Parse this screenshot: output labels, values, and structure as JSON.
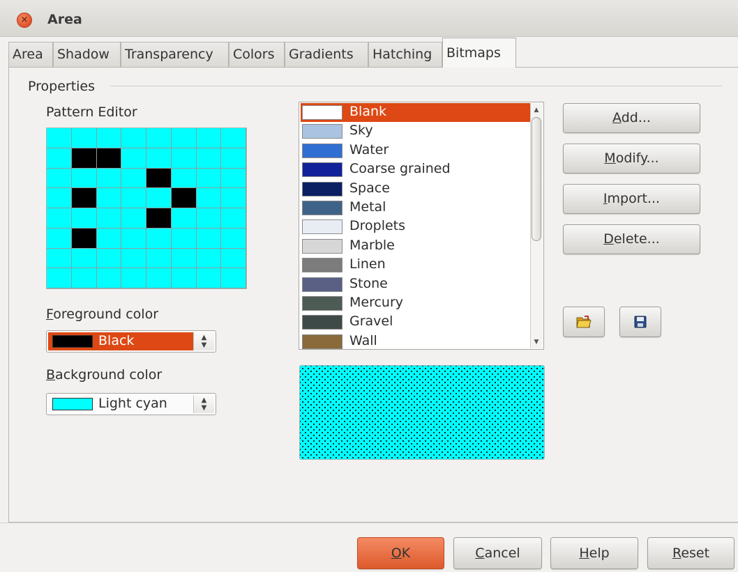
{
  "window": {
    "title": "Area",
    "close_glyph": "×"
  },
  "tabs": [
    {
      "label": "Area",
      "active": false
    },
    {
      "label": "Shadow",
      "active": false
    },
    {
      "label": "Transparency",
      "active": false
    },
    {
      "label": "Colors",
      "active": false
    },
    {
      "label": "Gradients",
      "active": false
    },
    {
      "label": "Hatching",
      "active": false
    },
    {
      "label": "Bitmaps",
      "active": true
    }
  ],
  "properties": {
    "section_label": "Properties",
    "pattern_editor_label": "Pattern Editor",
    "pattern_grid": {
      "rows": 8,
      "cols": 8,
      "cell_color": "#00ffff",
      "on_color": "#000000",
      "on_cells": [
        [
          1,
          1
        ],
        [
          1,
          2
        ],
        [
          2,
          4
        ],
        [
          3,
          1
        ],
        [
          3,
          5
        ],
        [
          4,
          4
        ],
        [
          5,
          1
        ]
      ]
    },
    "foreground": {
      "label_u": "F",
      "label_rest": "oreground color",
      "value": "Black",
      "swatch": "#000000",
      "selected": true
    },
    "background": {
      "label_u": "B",
      "label_rest": "ackground color",
      "value": "Light cyan",
      "swatch": "#00ffff"
    }
  },
  "bitmap_list": {
    "items": [
      {
        "label": "Blank",
        "thumb": "#ffffff",
        "selected": true
      },
      {
        "label": "Sky",
        "thumb": "#a9c3e0"
      },
      {
        "label": "Water",
        "thumb": "#2f6fd1"
      },
      {
        "label": "Coarse grained",
        "thumb": "#12229a"
      },
      {
        "label": "Space",
        "thumb": "#0b1f63"
      },
      {
        "label": "Metal",
        "thumb": "#3f6388"
      },
      {
        "label": "Droplets",
        "thumb": "#e8edf4"
      },
      {
        "label": "Marble",
        "thumb": "#d7d7d7"
      },
      {
        "label": "Linen",
        "thumb": "#7c7c7c"
      },
      {
        "label": "Stone",
        "thumb": "#596084"
      },
      {
        "label": "Mercury",
        "thumb": "#4c5c55"
      },
      {
        "label": "Gravel",
        "thumb": "#3e4a48"
      },
      {
        "label": "Wall",
        "thumb": "#8a6a3a"
      }
    ],
    "selection_color": "#dd4814"
  },
  "preview": {
    "background": "#00ffff"
  },
  "actions": [
    {
      "u": "A",
      "rest": "dd..."
    },
    {
      "u": "M",
      "rest": "odify..."
    },
    {
      "u": "I",
      "rest": "mport..."
    },
    {
      "u": "D",
      "rest": "elete..."
    }
  ],
  "footer": {
    "ok": {
      "u": "O",
      "rest": "K"
    },
    "cancel": {
      "u": "C",
      "rest": "ancel"
    },
    "help": {
      "u": "H",
      "rest": "elp"
    },
    "reset": {
      "u": "R",
      "rest": "eset"
    }
  },
  "colors": {
    "accent": "#dd4814",
    "cyan": "#00ffff"
  }
}
